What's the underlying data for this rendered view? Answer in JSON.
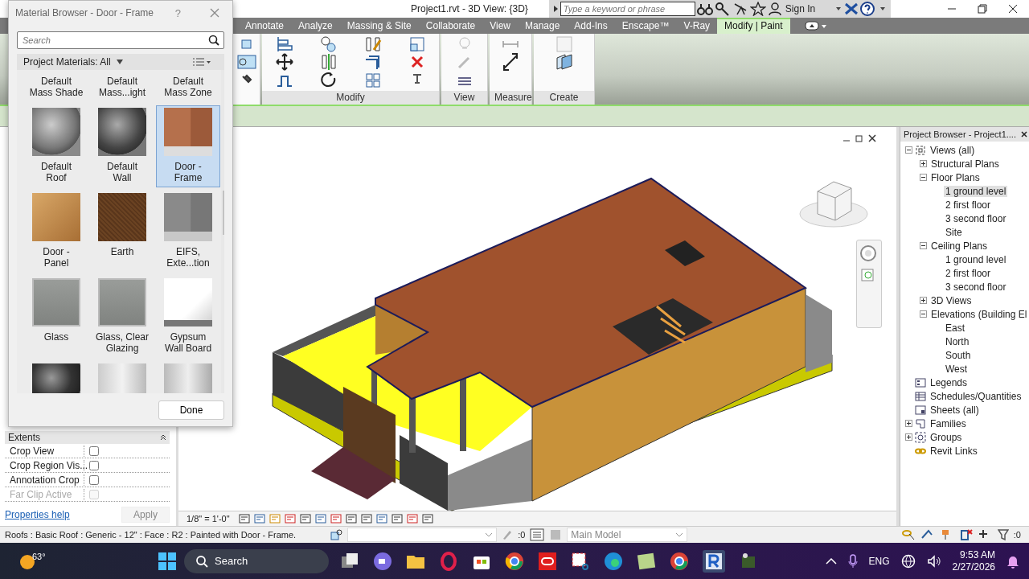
{
  "title_bar": {
    "title": "Project1.rvt - 3D View: {3D}",
    "search": {
      "placeholder": "Type a keyword or phrase"
    },
    "sign_in": "Sign In"
  },
  "ribbon_tabs": [
    {
      "label": "Annotate",
      "selected": false
    },
    {
      "label": "Analyze",
      "selected": false
    },
    {
      "label": "Massing & Site",
      "selected": false
    },
    {
      "label": "Collaborate",
      "selected": false
    },
    {
      "label": "View",
      "selected": false
    },
    {
      "label": "Manage",
      "selected": false
    },
    {
      "label": "Add-Ins",
      "selected": false
    },
    {
      "label": "Enscape™",
      "selected": false
    },
    {
      "label": "V-Ray",
      "selected": false
    },
    {
      "label": "Modify | Paint",
      "selected": true
    }
  ],
  "ribbon_panels": [
    {
      "label": "Modify"
    },
    {
      "label": "View"
    },
    {
      "label": "Measure"
    },
    {
      "label": "Create"
    }
  ],
  "material_browser": {
    "title": "Material Browser - Door - Frame",
    "help": "?",
    "search": {
      "placeholder": "Search"
    },
    "filter": "Project Materials: All",
    "materials": [
      {
        "name": "Default\nMass Shade",
        "selected": false
      },
      {
        "name": "Default\nMass...ight",
        "selected": false
      },
      {
        "name": "Default\nMass Zone",
        "selected": false
      },
      {
        "name": "Default\nRoof",
        "kind": "sphere-light",
        "selected": false
      },
      {
        "name": "Default\nWall",
        "kind": "sphere-dark",
        "selected": false
      },
      {
        "name": "Door -\nFrame",
        "kind": "wall-brown",
        "selected": true
      },
      {
        "name": "Door -\nPanel",
        "kind": "cube-wood",
        "selected": false
      },
      {
        "name": "Earth",
        "kind": "earth",
        "selected": false
      },
      {
        "name": "EIFS,\nExte...tion",
        "kind": "wall-gray",
        "selected": false
      },
      {
        "name": "Glass",
        "kind": "glass",
        "selected": false
      },
      {
        "name": "Glass, Clear\nGlazing",
        "kind": "glass",
        "selected": false
      },
      {
        "name": "Gypsum\nWall Board",
        "kind": "cube-white",
        "selected": false
      },
      {
        "kind": "sphere-black",
        "selected": false
      },
      {
        "kind": "cylinder",
        "selected": false
      },
      {
        "kind": "cloth",
        "selected": false
      }
    ],
    "done": "Done"
  },
  "properties": {
    "section": "Extents",
    "rows": [
      {
        "label": "Crop View",
        "checked": false,
        "disabled": false
      },
      {
        "label": "Crop Region Vis...",
        "checked": false,
        "disabled": false
      },
      {
        "label": "Annotation Crop",
        "checked": false,
        "disabled": false
      },
      {
        "label": "Far Clip Active",
        "checked": false,
        "disabled": true
      }
    ],
    "help_link": "Properties help",
    "apply": {
      "label": "Apply",
      "disabled": true
    }
  },
  "view_control_bar": {
    "scale": "1/8\" = 1'-0\""
  },
  "project_browser": {
    "title": "Project Browser - Project1....",
    "tree": [
      {
        "label": "Views (all)",
        "kind": "views",
        "expanded": true,
        "selected": false,
        "children": [
          {
            "label": "Structural Plans",
            "expanded": false,
            "selected": false
          },
          {
            "label": "Floor Plans",
            "expanded": true,
            "selected": false,
            "children": [
              {
                "label": "1 ground level",
                "selected": true
              },
              {
                "label": "2 first floor",
                "selected": false
              },
              {
                "label": "3 second floor",
                "selected": false
              },
              {
                "label": "Site",
                "selected": false
              }
            ]
          },
          {
            "label": "Ceiling Plans",
            "expanded": true,
            "selected": false,
            "children": [
              {
                "label": "1 ground level",
                "selected": false
              },
              {
                "label": "2 first floor",
                "selected": false
              },
              {
                "label": "3 second floor",
                "selected": false
              }
            ]
          },
          {
            "label": "3D Views",
            "expanded": false,
            "selected": false
          },
          {
            "label": "Elevations (Building El",
            "expanded": true,
            "selected": false,
            "children": [
              {
                "label": "East",
                "selected": false
              },
              {
                "label": "North",
                "selected": false
              },
              {
                "label": "South",
                "selected": false
              },
              {
                "label": "West",
                "selected": false
              }
            ]
          }
        ]
      },
      {
        "label": "Legends",
        "kind": "legend",
        "selected": false
      },
      {
        "label": "Schedules/Quantities",
        "kind": "schedule",
        "selected": false
      },
      {
        "label": "Sheets (all)",
        "kind": "sheet",
        "selected": false
      },
      {
        "label": "Families",
        "kind": "family",
        "expanded": false,
        "selected": false
      },
      {
        "label": "Groups",
        "kind": "group",
        "expanded": false,
        "selected": false
      },
      {
        "label": "Revit Links",
        "kind": "link",
        "selected": false
      }
    ]
  },
  "status_bar": {
    "message": "Roofs : Basic Roof : Generic - 12\" : Face : R2 : Painted with Door - Frame.",
    "selection_count": ":0",
    "workset": "Main Model",
    "filter_count": ":0"
  },
  "taskbar": {
    "weather": "63°",
    "search": "Search",
    "language": "ENG",
    "time": "9:53 AM",
    "date": "2/27/2026"
  }
}
